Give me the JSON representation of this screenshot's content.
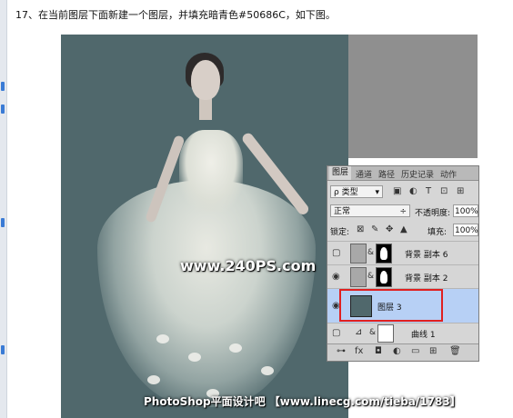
{
  "instruction": "17、在当前图层下面新建一个图层，并填充暗青色#50686C，如下图。",
  "fill_color": "#50686C",
  "watermark_center": "www.240PS.com",
  "watermark_bottom": "PhotoShop平面设计吧 【www.linecg.com/tieba/1783】",
  "panel": {
    "tabs": [
      "图层",
      "通道",
      "路径",
      "历史记录",
      "动作"
    ],
    "filter_label": "ρ 类型",
    "blend_mode": "正常",
    "opacity_label": "不透明度:",
    "opacity_value": "100%",
    "lock_label": "锁定:",
    "fill_label": "填充:",
    "fill_value": "100%",
    "layers": [
      {
        "name": "背景 副本 6",
        "visible": false,
        "selected": false
      },
      {
        "name": "背景 副本 2",
        "visible": true,
        "selected": false
      },
      {
        "name": "图层 3",
        "visible": true,
        "selected": true
      },
      {
        "name": "曲线 1",
        "visible": false,
        "selected": false
      }
    ],
    "bottom_icons": [
      "link-icon",
      "fx-icon",
      "mask-icon",
      "adjustment-icon",
      "folder-icon",
      "new-layer-icon",
      "trash-icon"
    ]
  }
}
